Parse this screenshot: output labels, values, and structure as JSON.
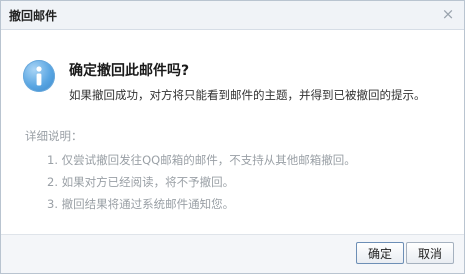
{
  "dialog": {
    "title": "撤回邮件",
    "close_glyph": "×",
    "question": "确定撤回此邮件吗?",
    "explanation": "如果撤回成功，对方将只能看到邮件的主题，并得到已被撤回的提示。",
    "detail_title": "详细说明：",
    "details": [
      "1. 仅尝试撤回发往QQ邮箱的邮件，不支持从其他邮箱撤回。",
      "2. 如果对方已经阅读，将不予撤回。",
      "3. 撤回结果将通过系统邮件通知您。"
    ],
    "buttons": {
      "ok": "确定",
      "cancel": "取消"
    }
  },
  "icons": {
    "info": "info-icon",
    "close": "close-icon"
  },
  "colors": {
    "accent": "#58a5e2",
    "muted_text": "#9aa0a6"
  }
}
